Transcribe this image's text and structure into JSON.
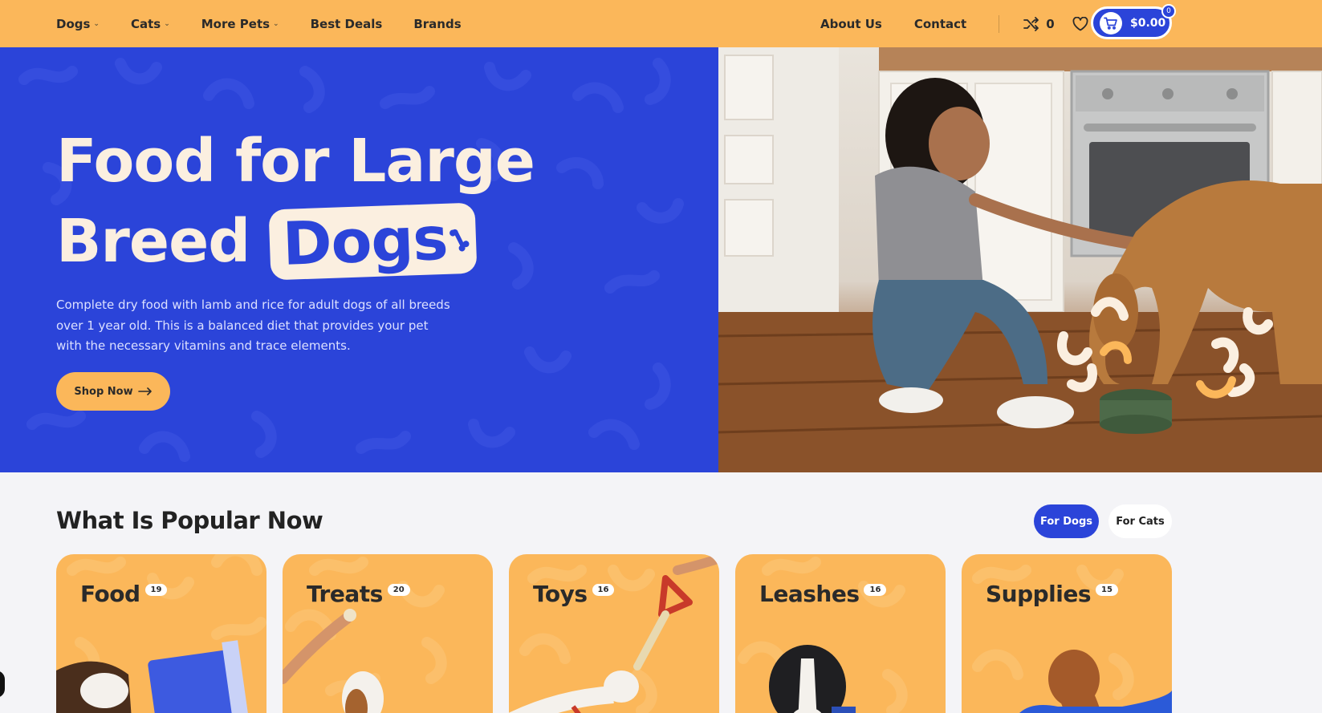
{
  "header": {
    "nav_left": [
      {
        "label": "Dogs",
        "has_dropdown": true
      },
      {
        "label": "Cats",
        "has_dropdown": true
      },
      {
        "label": "More Pets",
        "has_dropdown": true
      },
      {
        "label": "Best Deals",
        "has_dropdown": false
      },
      {
        "label": "Brands",
        "has_dropdown": false
      }
    ],
    "nav_right": [
      {
        "label": "About Us"
      },
      {
        "label": "Contact"
      }
    ],
    "compare_count": "0",
    "wishlist_count": "0",
    "cart_total": "$0.00",
    "cart_count": "0",
    "icons": {
      "compare": "shuffle-icon",
      "wishlist": "heart-icon",
      "cart": "cart-icon"
    }
  },
  "hero": {
    "title_line1": "Food for Large",
    "title_line2_plain": "Breed",
    "title_line2_highlight": "Dogs",
    "description": "Complete dry food with lamb and rice for adult dogs of all breeds over 1 year old. This is a balanced diet that provides your pet with the necessary vitamins and trace elements.",
    "cta_label": "Shop Now",
    "cta_icon": "arrow-right-icon",
    "image_subject": "woman-feeding-dog-photo"
  },
  "popular": {
    "title": "What Is Popular Now",
    "tabs": [
      {
        "label": "For Dogs",
        "active": true
      },
      {
        "label": "For Cats",
        "active": false
      }
    ],
    "categories": [
      {
        "name": "Food",
        "count": "19"
      },
      {
        "name": "Treats",
        "count": "20"
      },
      {
        "name": "Toys",
        "count": "16"
      },
      {
        "name": "Leashes",
        "count": "16"
      },
      {
        "name": "Supplies",
        "count": "15"
      }
    ]
  },
  "colors": {
    "accent_blue": "#2b44d9",
    "accent_orange": "#fbb75a",
    "cream": "#fbefe0",
    "page_bg": "#f4f4f7"
  }
}
